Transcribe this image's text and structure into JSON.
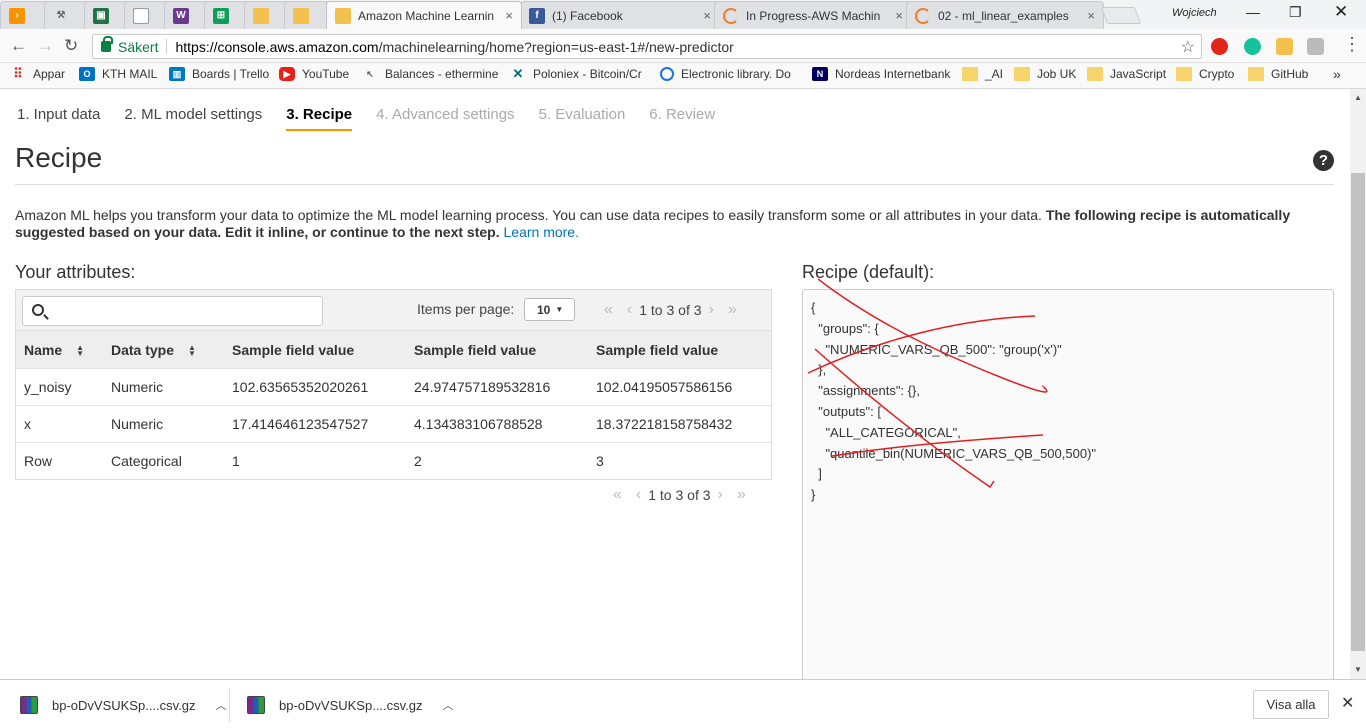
{
  "browser": {
    "tabs": [
      {
        "label": "",
        "icon": "aws-icon",
        "color": "#f79400"
      },
      {
        "label": "",
        "icon": "tool-icon",
        "color": "#888888"
      },
      {
        "label": "",
        "icon": "sheet-icon",
        "color": "#217346"
      },
      {
        "label": "",
        "icon": "doc-icon",
        "color": "#999999"
      },
      {
        "label": "",
        "icon": "w-icon",
        "color": "#6b3a8f"
      },
      {
        "label": "",
        "icon": "grid-icon",
        "color": "#0f9d58"
      },
      {
        "label": "",
        "icon": "box-icon",
        "color": "#f4c04d"
      },
      {
        "label": "",
        "icon": "box-icon",
        "color": "#f4c04d"
      },
      {
        "label": "Amazon Machine Learnin",
        "icon": "box-icon",
        "color": "#f4c04d"
      },
      {
        "label": "(1) Facebook",
        "icon": "facebook-icon",
        "color": "#3b5998"
      },
      {
        "label": "In Progress-AWS Machin",
        "icon": "loading-icon",
        "color": "#f47b20"
      },
      {
        "label": "02 - ml_linear_examples",
        "icon": "loading-icon",
        "color": "#f47b20"
      }
    ],
    "profile_name": "Wojciech",
    "secure_label": "Säkert",
    "url_domain": "https://console.aws.amazon.com",
    "url_path": "/machinelearning/home?region=us-east-1#/new-predictor",
    "bookmarks": [
      {
        "label": "Appar",
        "icon": "apps-grid-icon"
      },
      {
        "label": "KTH MAIL",
        "icon": "outlook-icon"
      },
      {
        "label": "Boards | Trello",
        "icon": "trello-icon"
      },
      {
        "label": "YouTube",
        "icon": "youtube-icon"
      },
      {
        "label": "Balances - ethermine",
        "icon": "ethermine-icon"
      },
      {
        "label": "Poloniex - Bitcoin/Cr",
        "icon": "poloniex-icon"
      },
      {
        "label": "Electronic library. Do",
        "icon": "globe-icon"
      },
      {
        "label": "Nordeas Internetbank",
        "icon": "nordea-icon"
      },
      {
        "label": "_AI",
        "icon": "folder-icon"
      },
      {
        "label": "Job UK",
        "icon": "folder-icon"
      },
      {
        "label": "JavaScript",
        "icon": "folder-icon"
      },
      {
        "label": "Crypto",
        "icon": "folder-icon"
      },
      {
        "label": "GitHub",
        "icon": "folder-icon"
      }
    ],
    "bookmarks_more": "»"
  },
  "wizard": {
    "steps": [
      {
        "label": "1. Input data",
        "state": "done"
      },
      {
        "label": "2. ML model settings",
        "state": "done"
      },
      {
        "label": "3. Recipe",
        "state": "current"
      },
      {
        "label": "4. Advanced settings",
        "state": "disabled"
      },
      {
        "label": "5. Evaluation",
        "state": "disabled"
      },
      {
        "label": "6. Review",
        "state": "disabled"
      }
    ],
    "title": "Recipe",
    "help": "?",
    "intro_text": "Amazon ML helps you transform your data to optimize the ML model learning process. You can use data recipes to easily transform some or all attributes in your data.",
    "intro_bold": "The following recipe is automatically suggested based on your data. Edit it inline, or continue to the next step.",
    "learn_more": "Learn more."
  },
  "attributes": {
    "label": "Your attributes:",
    "items_per_page_label": "Items per page:",
    "items_per_page_value": "10",
    "pagination_top": "1 to 3 of 3",
    "pagination_bottom": "1 to 3 of 3",
    "columns": [
      "Name",
      "Data type",
      "Sample field value",
      "Sample field value",
      "Sample field value"
    ],
    "rows": [
      [
        "y_noisy",
        "Numeric",
        "102.63565352020261",
        "24.974757189532816",
        "102.04195057586156"
      ],
      [
        "x",
        "Numeric",
        "17.414646123547527",
        "4.134383106788528",
        "18.372218158758432"
      ],
      [
        "Row",
        "Categorical",
        "1",
        "2",
        "3"
      ]
    ]
  },
  "recipe": {
    "label": "Recipe (default):",
    "text": "{\n  \"groups\": {\n    \"NUMERIC_VARS_QB_500\": \"group('x')\"\n  },\n  \"assignments\": {},\n  \"outputs\": [\n    \"ALL_CATEGORICAL\",\n    \"quantile_bin(NUMERIC_VARS_QB_500,500)\"\n  ]\n}"
  },
  "downloads": {
    "items": [
      {
        "label": "bp-oDvVSUKSp....csv.gz"
      },
      {
        "label": "bp-oDvVSUKSp....csv.gz"
      }
    ],
    "show_all": "Visa alla"
  },
  "colors": {
    "accent_orange": "#f79400",
    "link_blue": "#0073bb",
    "secure_green": "#0b8043",
    "scribble_red": "#e02020"
  }
}
